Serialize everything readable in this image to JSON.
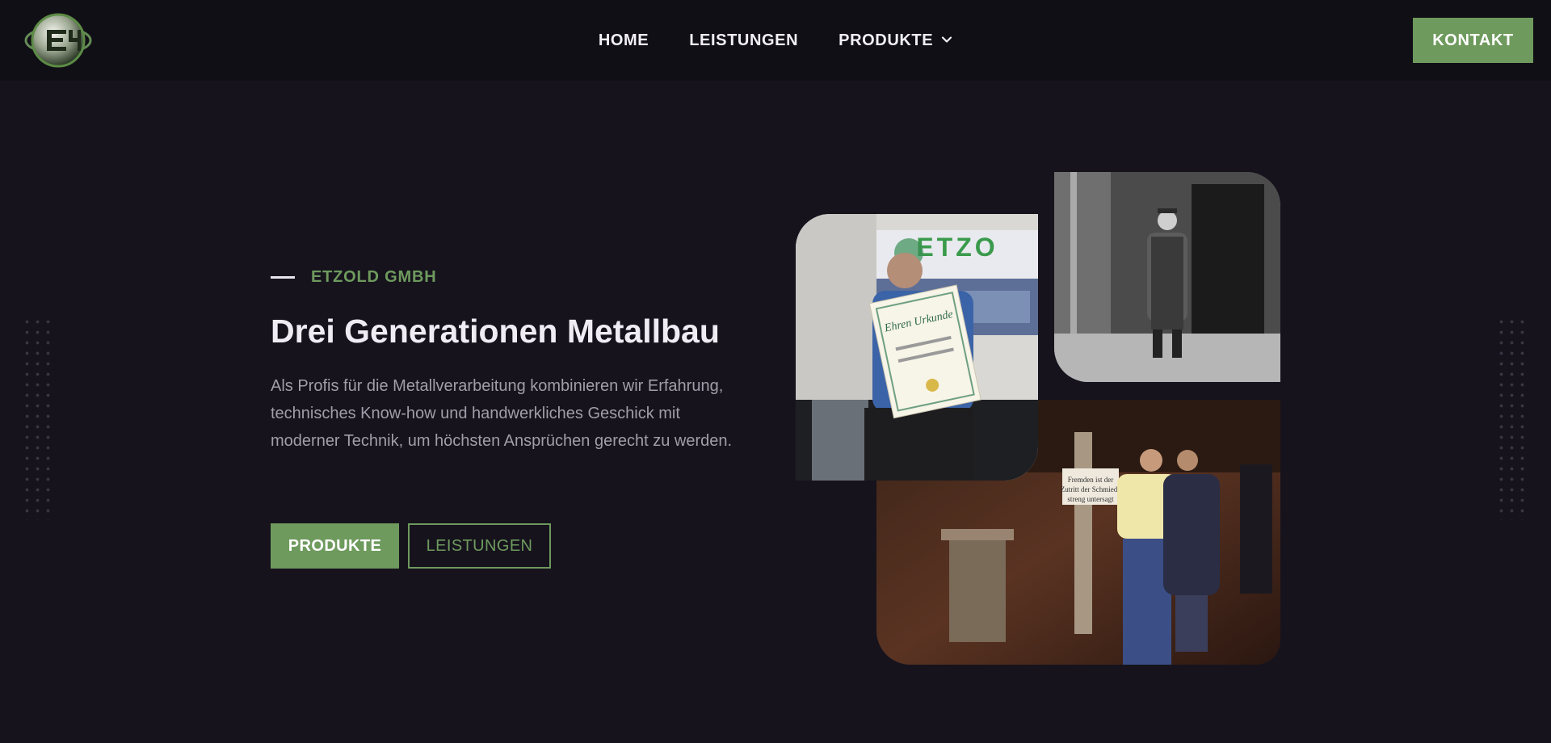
{
  "header": {
    "logo_alt": "Etzold logo",
    "nav": [
      {
        "label": "HOME"
      },
      {
        "label": "LEISTUNGEN"
      },
      {
        "label": "PRODUKTE",
        "icon": "chevron-down-icon"
      }
    ],
    "cta_label": "KONTAKT"
  },
  "hero": {
    "eyebrow": "ETZOLD GMBH",
    "title": "Drei Generationen Metallbau",
    "description": "Als Profis für die Metallverarbeitung kombinieren wir Erfahrung, technisches Know-how und handwerkliches Geschick mit moderner Technik, um höchsten Ansprüchen gerecht zu werden.",
    "primary_button": "PRODUKTE",
    "secondary_button": "LEISTUNGEN"
  },
  "photos": {
    "award_sign_text": "ETZO",
    "award_certificate_text": "Ehren Urkunde",
    "workshop_sign_text": "Fremden ist der Zutritt der Schmiede streng untersagt"
  },
  "colors": {
    "background": "#16131d",
    "header_background": "#110f16",
    "accent": "#6e9a5d",
    "text": "#ece9f1",
    "muted": "#a19eaa"
  }
}
